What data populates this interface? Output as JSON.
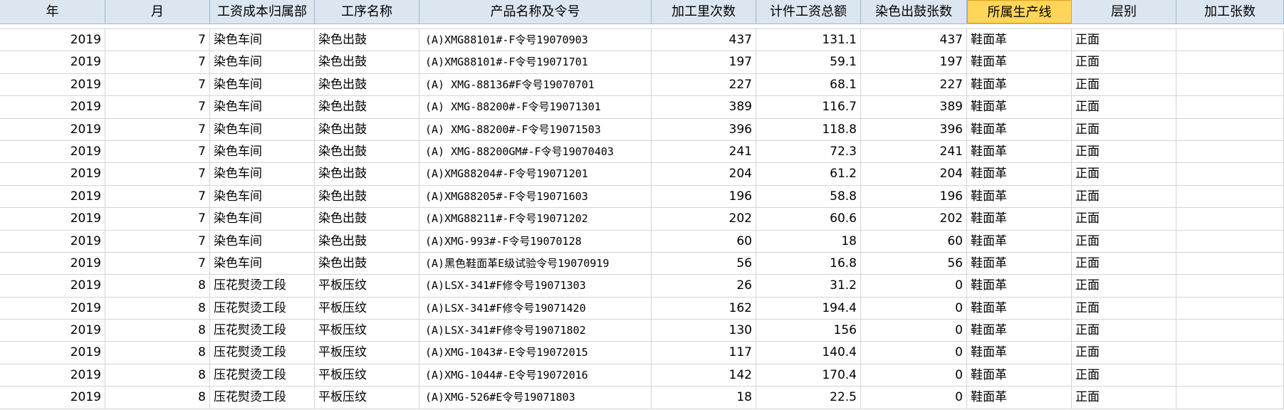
{
  "columns": [
    "年",
    "月",
    "工资成本归属部",
    "工序名称",
    "产品名称及令号",
    "加工里次数",
    "计件工资总额",
    "染色出鼓张数",
    "所属生产线",
    "层别",
    "加工张数"
  ],
  "selected_column": "所属生产线",
  "rows": [
    [
      "2019",
      "7",
      "染色车间",
      "染色出鼓",
      "(A)XMG88101#-F令号19070903",
      "437",
      "131.1",
      "437",
      "鞋面革",
      "正面",
      ""
    ],
    [
      "2019",
      "7",
      "染色车间",
      "染色出鼓",
      "(A)XMG88101#-F令号19071701",
      "197",
      "59.1",
      "197",
      "鞋面革",
      "正面",
      ""
    ],
    [
      "2019",
      "7",
      "染色车间",
      "染色出鼓",
      "(A) XMG-88136#F令号19070701",
      "227",
      "68.1",
      "227",
      "鞋面革",
      "正面",
      ""
    ],
    [
      "2019",
      "7",
      "染色车间",
      "染色出鼓",
      "(A) XMG-88200#-F令号19071301",
      "389",
      "116.7",
      "389",
      "鞋面革",
      "正面",
      ""
    ],
    [
      "2019",
      "7",
      "染色车间",
      "染色出鼓",
      "(A) XMG-88200#-F令号19071503",
      "396",
      "118.8",
      "396",
      "鞋面革",
      "正面",
      ""
    ],
    [
      "2019",
      "7",
      "染色车间",
      "染色出鼓",
      "(A) XMG-88200GM#-F令号19070403",
      "241",
      "72.3",
      "241",
      "鞋面革",
      "正面",
      ""
    ],
    [
      "2019",
      "7",
      "染色车间",
      "染色出鼓",
      "(A)XMG88204#-F令号19071201",
      "204",
      "61.2",
      "204",
      "鞋面革",
      "正面",
      ""
    ],
    [
      "2019",
      "7",
      "染色车间",
      "染色出鼓",
      "(A)XMG88205#-F令号19071603",
      "196",
      "58.8",
      "196",
      "鞋面革",
      "正面",
      ""
    ],
    [
      "2019",
      "7",
      "染色车间",
      "染色出鼓",
      "(A)XMG88211#-F令号19071202",
      "202",
      "60.6",
      "202",
      "鞋面革",
      "正面",
      ""
    ],
    [
      "2019",
      "7",
      "染色车间",
      "染色出鼓",
      "(A)XMG-993#-F令号19070128",
      "60",
      "18",
      "60",
      "鞋面革",
      "正面",
      ""
    ],
    [
      "2019",
      "7",
      "染色车间",
      "染色出鼓",
      "(A)黑色鞋面革E级试验令号19070919",
      "56",
      "16.8",
      "56",
      "鞋面革",
      "正面",
      ""
    ],
    [
      "2019",
      "8",
      "压花熨烫工段",
      "平板压纹",
      "(A)LSX-341#F修令号19071303",
      "26",
      "31.2",
      "0",
      "鞋面革",
      "正面",
      ""
    ],
    [
      "2019",
      "8",
      "压花熨烫工段",
      "平板压纹",
      "(A)LSX-341#F修令号19071420",
      "162",
      "194.4",
      "0",
      "鞋面革",
      "正面",
      ""
    ],
    [
      "2019",
      "8",
      "压花熨烫工段",
      "平板压纹",
      "(A)LSX-341#F修令号19071802",
      "130",
      "156",
      "0",
      "鞋面革",
      "正面",
      ""
    ],
    [
      "2019",
      "8",
      "压花熨烫工段",
      "平板压纹",
      "(A)XMG-1043#-E令号19072015",
      "117",
      "140.4",
      "0",
      "鞋面革",
      "正面",
      ""
    ],
    [
      "2019",
      "8",
      "压花熨烫工段",
      "平板压纹",
      "(A)XMG-1044#-E令号19072016",
      "142",
      "170.4",
      "0",
      "鞋面革",
      "正面",
      ""
    ],
    [
      "2019",
      "8",
      "压花熨烫工段",
      "平板压纹",
      "(A)XMG-526#E令号19071803",
      "18",
      "22.5",
      "0",
      "鞋面革",
      "正面",
      ""
    ]
  ],
  "colors": {
    "header_bg": "#dce6f1",
    "selected_header_bg": "#ffd659",
    "gridline": "#d4d4d4"
  }
}
